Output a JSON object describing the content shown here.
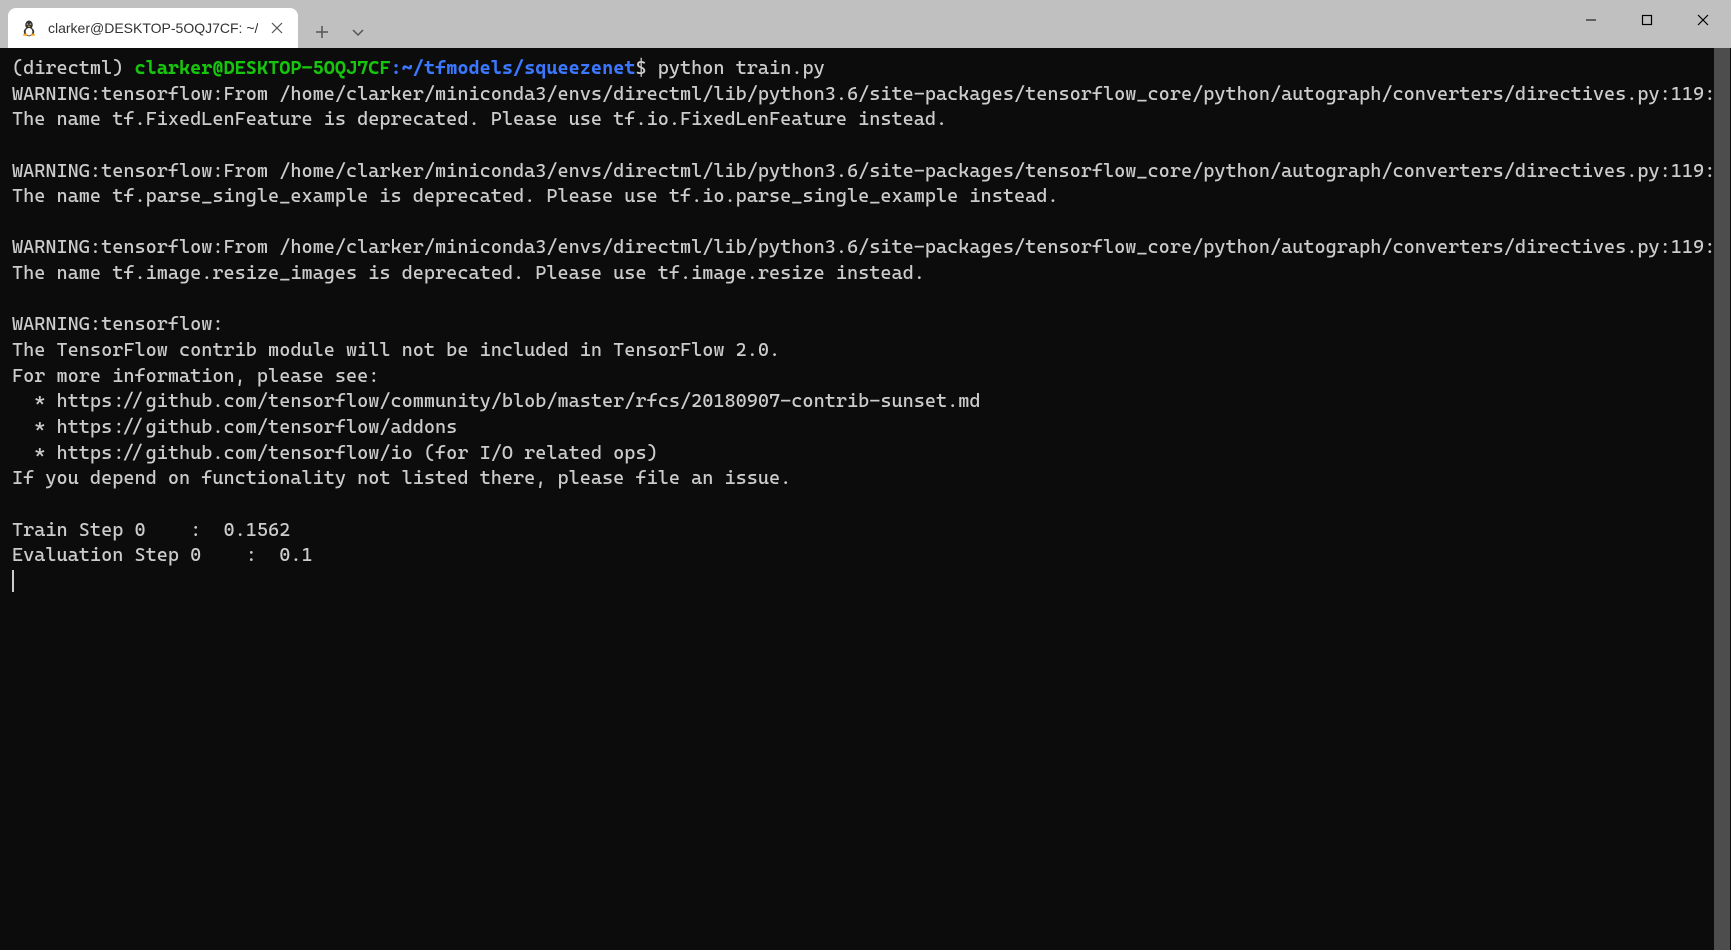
{
  "titlebar": {
    "tab_title": "clarker@DESKTOP-5OQJ7CF: ~/",
    "tab_icon": "linux-penguin-icon"
  },
  "prompt": {
    "env": "(directml) ",
    "user_host": "clarker@DESKTOP-5OQJ7CF",
    "colon": ":",
    "path": "~/tfmodels/squeezenet",
    "dollar": "$ ",
    "command": "python train.py"
  },
  "output": {
    "line1": "WARNING:tensorflow:From /home/clarker/miniconda3/envs/directml/lib/python3.6/site-packages/tensorflow_core/python/autograph/converters/directives.py:119: The name tf.FixedLenFeature is deprecated. Please use tf.io.FixedLenFeature instead.",
    "blank1": "",
    "line2": "WARNING:tensorflow:From /home/clarker/miniconda3/envs/directml/lib/python3.6/site-packages/tensorflow_core/python/autograph/converters/directives.py:119: The name tf.parse_single_example is deprecated. Please use tf.io.parse_single_example instead.",
    "blank2": "",
    "line3": "WARNING:tensorflow:From /home/clarker/miniconda3/envs/directml/lib/python3.6/site-packages/tensorflow_core/python/autograph/converters/directives.py:119: The name tf.image.resize_images is deprecated. Please use tf.image.resize instead.",
    "blank3": "",
    "line4": "WARNING:tensorflow:",
    "line5": "The TensorFlow contrib module will not be included in TensorFlow 2.0.",
    "line6": "For more information, please see:",
    "line7": "  * https://github.com/tensorflow/community/blob/master/rfcs/20180907-contrib-sunset.md",
    "line8": "  * https://github.com/tensorflow/addons",
    "line9": "  * https://github.com/tensorflow/io (for I/O related ops)",
    "line10": "If you depend on functionality not listed there, please file an issue.",
    "blank4": "",
    "line11": "Train Step 0    :  0.1562",
    "line12": "Evaluation Step 0    :  0.1"
  }
}
